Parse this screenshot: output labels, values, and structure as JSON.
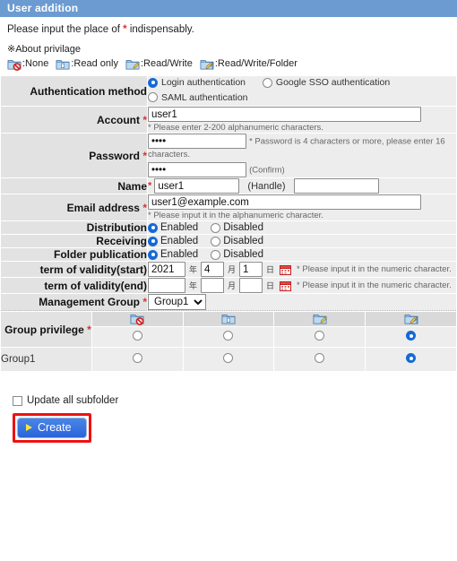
{
  "window": {
    "title": "User addition"
  },
  "intro": {
    "before": "Please input the place of ",
    "star": "*",
    "after": " indispensably."
  },
  "privilege_legend": {
    "heading": "※About privilage",
    "items": [
      {
        "icon": "folder-none-icon",
        "label": ":None"
      },
      {
        "icon": "folder-read-icon",
        "label": ":Read only"
      },
      {
        "icon": "folder-readwrite-icon",
        "label": ":Read/Write"
      },
      {
        "icon": "folder-readwritefolder-icon",
        "label": ":Read/Write/Folder"
      }
    ]
  },
  "form": {
    "auth": {
      "label": "Authentication method",
      "options": [
        {
          "label": "Login authentication",
          "selected": true
        },
        {
          "label": "Google SSO authentication",
          "selected": false
        },
        {
          "label": "SAML authentication",
          "selected": false
        }
      ]
    },
    "account": {
      "label": "Account",
      "required": "*",
      "value": "user1",
      "hint": "* Please enter 2-200 alphanumeric characters."
    },
    "password": {
      "label": "Password",
      "required": "*",
      "value": "••••",
      "hint": "* Password is 4 characters or more, please enter 16 characters.",
      "confirm_value": "••••",
      "confirm_label": "(Confirm)"
    },
    "name": {
      "label": "Name",
      "required": "*",
      "value": "user1",
      "handle_label": "(Handle)",
      "handle_value": ""
    },
    "email": {
      "label": "Email address",
      "required": "*",
      "value": "user1@example.com",
      "hint": "* Please input it in the alphanumeric character."
    },
    "distribution": {
      "label": "Distribution",
      "options": [
        {
          "label": "Enabled",
          "selected": true
        },
        {
          "label": "Disabled",
          "selected": false
        }
      ]
    },
    "receiving": {
      "label": "Receiving",
      "options": [
        {
          "label": "Enabled",
          "selected": true
        },
        {
          "label": "Disabled",
          "selected": false
        }
      ]
    },
    "folder_publication": {
      "label": "Folder publication",
      "options": [
        {
          "label": "Enabled",
          "selected": true
        },
        {
          "label": "Disabled",
          "selected": false
        }
      ]
    },
    "validity_start": {
      "label": "term of validity(start)",
      "year": "2021",
      "month": "4",
      "day": "1",
      "year_unit": "年",
      "month_unit": "月",
      "day_unit": "日",
      "hint": "* Please input it in the numeric character."
    },
    "validity_end": {
      "label": "term of validity(end)",
      "year": "",
      "month": "",
      "day": "",
      "year_unit": "年",
      "month_unit": "月",
      "day_unit": "日",
      "hint": "* Please input it in the numeric character."
    },
    "management_group": {
      "label": "Management Group",
      "required": "*",
      "selected": "Group1",
      "options": [
        "Group1"
      ]
    }
  },
  "group_privilege": {
    "label": "Group privilege",
    "required": "*",
    "columns": [
      {
        "icon": "folder-none-icon",
        "name": "None"
      },
      {
        "icon": "folder-read-icon",
        "name": "Read only"
      },
      {
        "icon": "folder-readwrite-icon",
        "name": "Read/Write"
      },
      {
        "icon": "folder-readwritefolder-icon",
        "name": "Read/Write/Folder"
      }
    ],
    "default_row": {
      "selected_index": 3
    },
    "rows": [
      {
        "name": "Group1",
        "selected_index": 3
      }
    ]
  },
  "footer": {
    "update_all_subfolder": {
      "label": "Update all subfolder",
      "checked": false
    },
    "create_button": {
      "label": "Create"
    }
  },
  "colors": {
    "title_bar": "#6b9bd1",
    "label_cell": "#e2e2e2",
    "value_cell": "#ededed",
    "required": "#e03030",
    "radio_on": "#1569d6",
    "button": "#2a64d8",
    "highlight": "#ee1111"
  }
}
